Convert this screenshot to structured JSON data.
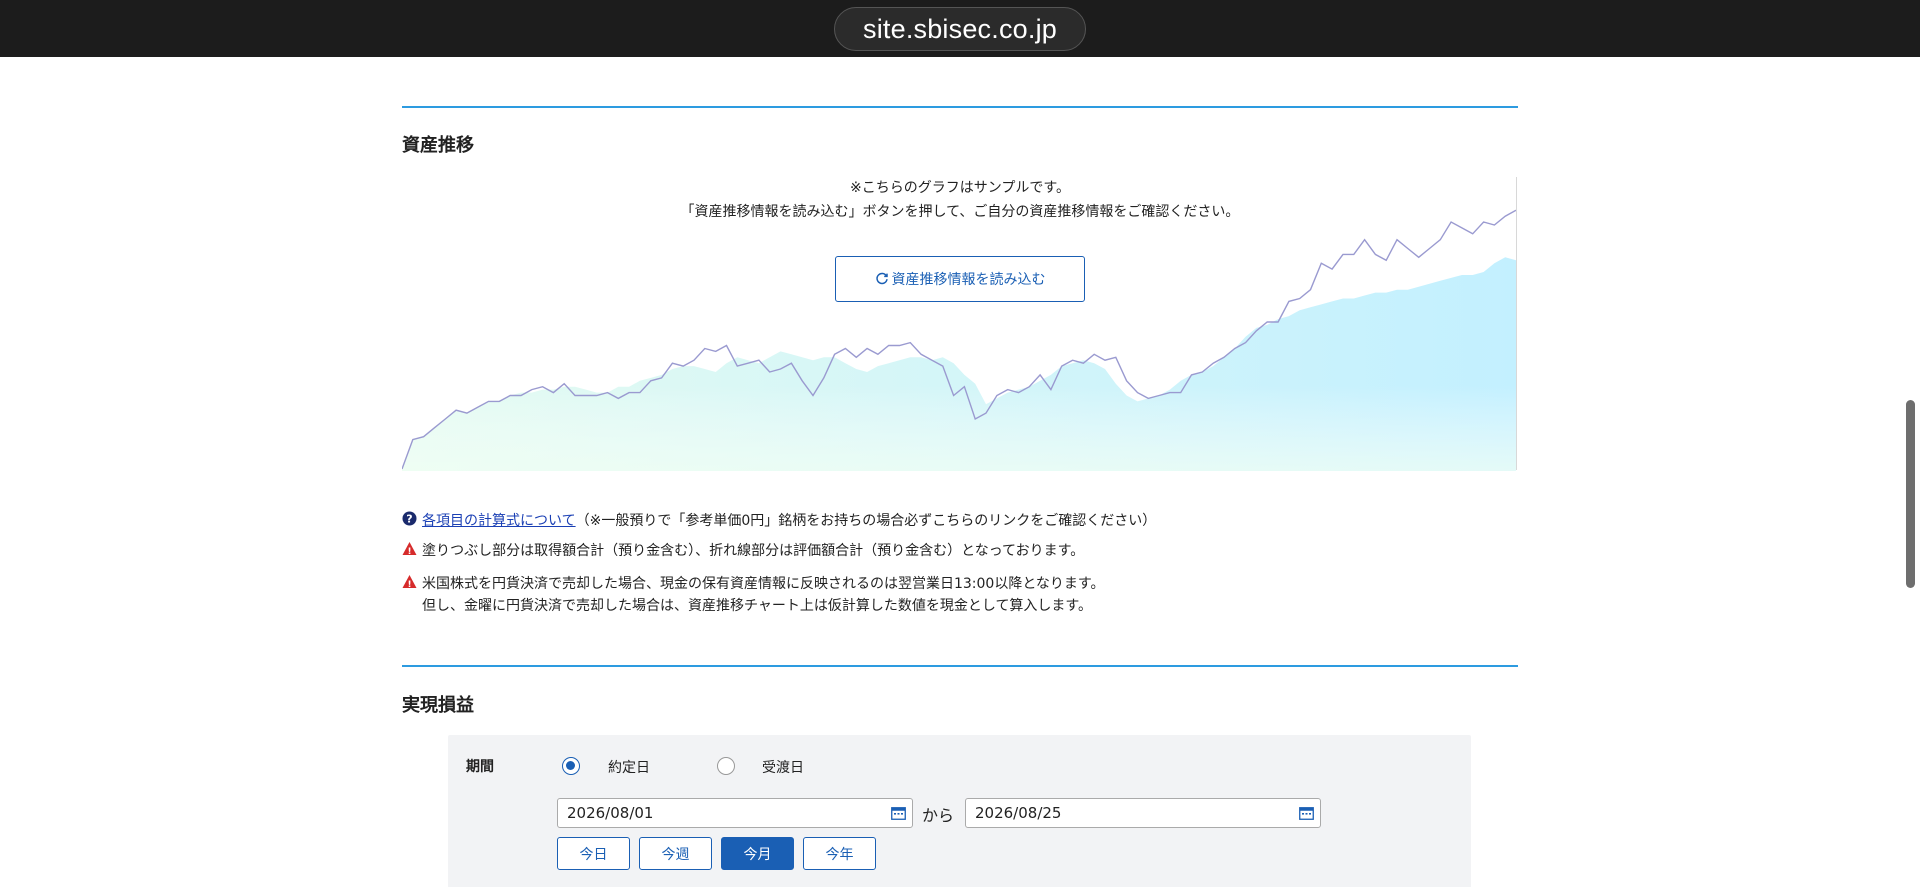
{
  "browser": {
    "url": "site.sbisec.co.jp"
  },
  "asset_section": {
    "title": "資産推移",
    "sample_notice": "※こちらのグラフはサンプルです。",
    "instruction": "「資産推移情報を読み込む」ボタンを押して、ご自分の資産推移情報をご確認ください。",
    "reload_label": "資産推移情報を読み込む"
  },
  "notes": {
    "formula_link": "各項目の計算式について",
    "formula_suffix": "（※一般預りで「参考単価0円」銘柄をお持ちの場合必ずこちらのリンクをご確認ください）",
    "fill_legend": "塗りつぶし部分は取得額合計（預り金含む）、折れ線部分は評価額合計（預り金含む）となっております。",
    "us_stock_line1": "米国株式を円貨決済で売却した場合、現金の保有資産情報に反映されるのは翌営業日13:00以降となります。",
    "us_stock_line2": "但し、金曜に円貨決済で売却した場合は、資産推移チャート上は仮計算した数値を現金として算入します。"
  },
  "realized_section": {
    "title": "実現損益",
    "period_label": "期間",
    "radio_trade_date": "約定日",
    "radio_settlement_date": "受渡日",
    "selected_radio": "約定日",
    "date_from": "2026/08/01",
    "date_to": "2026/08/25",
    "kara": "から",
    "buttons": [
      "今日",
      "今週",
      "今月",
      "今年"
    ],
    "active_button": "今月"
  },
  "colors": {
    "accent": "#2d9be0",
    "button_blue": "#1a5fb4",
    "line_color": "#9a9ad0",
    "fill_start": "#d0f7ef",
    "fill_end": "#c2f0ff",
    "warning_red": "#d62b2b"
  },
  "chart_data": {
    "type": "area",
    "ylim": [
      0,
      100
    ],
    "series": [
      {
        "values": [
          0,
          10,
          11,
          14,
          17,
          20,
          19,
          21,
          23,
          23,
          25,
          26,
          26,
          27,
          27,
          28,
          28,
          27,
          26,
          26,
          28,
          28,
          30,
          31,
          32,
          34,
          35,
          35,
          34,
          33,
          36,
          38,
          37,
          36,
          38,
          40,
          39,
          38,
          37,
          38,
          38,
          36,
          34,
          33,
          35,
          36,
          37,
          38,
          38,
          37,
          38,
          36,
          32,
          29,
          22,
          24,
          26,
          27,
          28,
          30,
          32,
          35,
          36,
          37,
          36,
          34,
          29,
          25,
          23,
          24,
          25,
          27,
          30,
          32,
          33,
          35,
          38,
          41,
          45,
          48,
          49,
          51,
          52,
          54,
          55,
          56,
          57,
          58,
          58,
          59,
          60,
          60,
          61,
          61,
          62,
          63,
          64,
          65,
          66,
          66,
          67,
          70,
          72,
          71
        ]
      },
      {
        "values": [
          0,
          10,
          11,
          14,
          17,
          20,
          19,
          21,
          23,
          23,
          25,
          25,
          27,
          28,
          26,
          29,
          25,
          25,
          25,
          26,
          24,
          26,
          26,
          30,
          31,
          36,
          35,
          37,
          41,
          40,
          42,
          35,
          36,
          37,
          33,
          34,
          36,
          30,
          25,
          31,
          39,
          41,
          38,
          41,
          39,
          42,
          42,
          43,
          39,
          37,
          35,
          25,
          28,
          17,
          19,
          25,
          27,
          26,
          28,
          32,
          27,
          35,
          37,
          36,
          39,
          37,
          38,
          30,
          26,
          24,
          25,
          26,
          26,
          32,
          33,
          36,
          38,
          41,
          43,
          47,
          50,
          50,
          57,
          58,
          61,
          70,
          68,
          73,
          73,
          78,
          73,
          71,
          78,
          75,
          72,
          75,
          78,
          84,
          82,
          80,
          84,
          83,
          86,
          88
        ]
      }
    ]
  }
}
